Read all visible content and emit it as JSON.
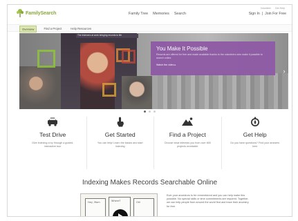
{
  "header": {
    "logo_text": "FamilySearch",
    "nav": [
      "Family Tree",
      "Memories",
      "Search"
    ],
    "utility_links": [
      "Volunteer",
      "Get Help"
    ],
    "sign_in": "Sign In",
    "separator": "|",
    "join": "Join For Free"
  },
  "subnav": {
    "items": [
      "Overview",
      "Find a Project",
      "Help Resources"
    ],
    "active": "Overview"
  },
  "hero": {
    "caption": "The Indexers at work bringing records to life",
    "title": "You Make It Possible",
    "description": "Records are offered for free and made available thanks to the volunteers who make it possible to search online.",
    "link": "Watch the video ▸",
    "slide_count": 3,
    "active_slide": 0
  },
  "features": [
    {
      "title": "Test Drive",
      "icon": "car-icon",
      "description": "Give indexing a try through a guided, interactive tour"
    },
    {
      "title": "Get Started",
      "icon": "pointer-hand-icon",
      "description": "You can help! Learn the basics and start indexing"
    },
    {
      "title": "Find a Project",
      "icon": "mountain-icon",
      "description": "Choose what interests you from over 800 projects worldwide"
    },
    {
      "title": "Get Help",
      "icon": "compass-icon",
      "description": "Do you have questions? Find your answers here"
    }
  ],
  "indexing": {
    "title": "Indexing Makes Records Searchable Online",
    "body": "Ever your ancestors to be remembered and you can help make this possible. No special skills or time commitments are required. Together, we can help people from around the world find and trace their ancestry for free.",
    "comic_labels": [
      "Hey, Mom",
      "Where?",
      "Oh!"
    ]
  },
  "colors": {
    "brand_green": "#8aa83b",
    "hero_overlay": "#8e5aa5",
    "active_tab": "#dbe6b3"
  }
}
